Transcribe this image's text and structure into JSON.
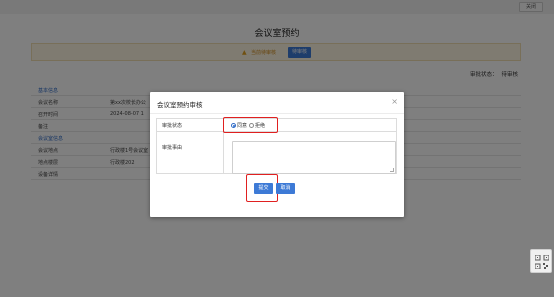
{
  "topbar": {
    "close_label": "关闭"
  },
  "page": {
    "title": "会议室预约",
    "notice": {
      "text": "当前待审核",
      "button": "待审核"
    },
    "status": {
      "label": "审批状态：",
      "value": "待审核"
    },
    "rows": [
      {
        "label": "基本信息",
        "value": "",
        "section": true
      },
      {
        "label": "会议名称",
        "value": "第xx次校长办公"
      },
      {
        "label": "召开时间",
        "value": "2024-08-07 1"
      },
      {
        "label": "备注",
        "value": ""
      },
      {
        "label": "会议室信息",
        "value": "",
        "section": true
      },
      {
        "label": "会议地点",
        "value": "行政楼1号会议室"
      },
      {
        "label": "地点楼层",
        "value": "行政楼202"
      },
      {
        "label": "设备详情",
        "value": ""
      }
    ]
  },
  "modal": {
    "title": "会议室预约审核",
    "close_glyph": "×",
    "status_label": "审批状态",
    "option_agree": "同意",
    "option_reject": "拒绝",
    "selected": "同意",
    "reason_label": "审批事由",
    "reason_value": "",
    "submit_label": "提交",
    "cancel_label": "取消"
  },
  "colors": {
    "primary": "#3d7ad6",
    "highlight": "#e02020",
    "overlay": "rgba(0,0,0,0.5)"
  }
}
